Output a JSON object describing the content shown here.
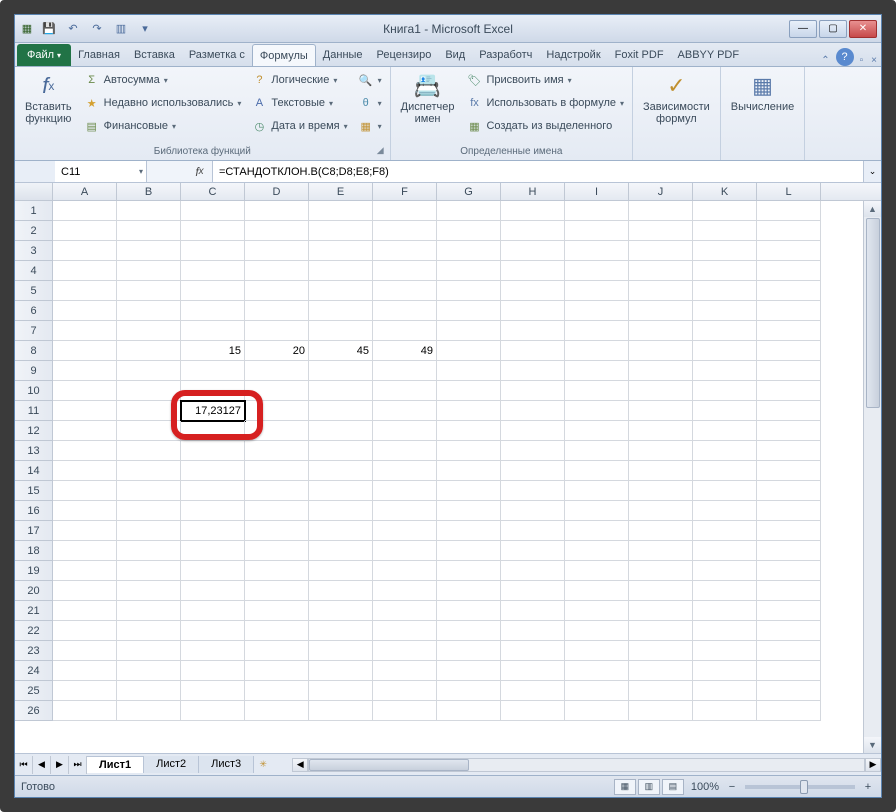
{
  "title": "Книга1 - Microsoft Excel",
  "qat": {
    "excel": "X",
    "save": "💾",
    "undo": "↶",
    "redo": "↷",
    "new": "▥"
  },
  "tabs": {
    "file": "Файл",
    "items": [
      "Главная",
      "Вставка",
      "Разметка с",
      "Формулы",
      "Данные",
      "Рецензиро",
      "Вид",
      "Разработч",
      "Надстройк",
      "Foxit PDF",
      "ABBYY PDF"
    ],
    "active": 3
  },
  "ribbon": {
    "insert_fn": {
      "label": "Вставить\nфункцию",
      "icon": "fx"
    },
    "lib": {
      "autosum": "Автосумма",
      "recent": "Недавно использовались",
      "financial": "Финансовые",
      "logical": "Логические",
      "text": "Текстовые",
      "date": "Дата и время",
      "label": "Библиотека функций"
    },
    "names": {
      "manager": "Диспетчер\nимен",
      "define": "Присвоить имя",
      "use": "Использовать в формуле",
      "create": "Создать из выделенного",
      "label": "Определенные имена"
    },
    "deps": {
      "label": "Зависимости\nформул"
    },
    "calc": {
      "label": "Вычисление"
    }
  },
  "namebox": "C11",
  "formula": "=СТАНДОТКЛОН.В(C8;D8;E8;F8)",
  "columns": [
    "A",
    "B",
    "C",
    "D",
    "E",
    "F",
    "G",
    "H",
    "I",
    "J",
    "K",
    "L"
  ],
  "rows": 26,
  "cells": {
    "C8": "15",
    "D8": "20",
    "E8": "45",
    "F8": "49",
    "C11": "17,23127"
  },
  "selected": "C11",
  "sheets": {
    "items": [
      "Лист1",
      "Лист2",
      "Лист3"
    ],
    "active": 0
  },
  "status": {
    "ready": "Готово",
    "zoom": "100%"
  }
}
